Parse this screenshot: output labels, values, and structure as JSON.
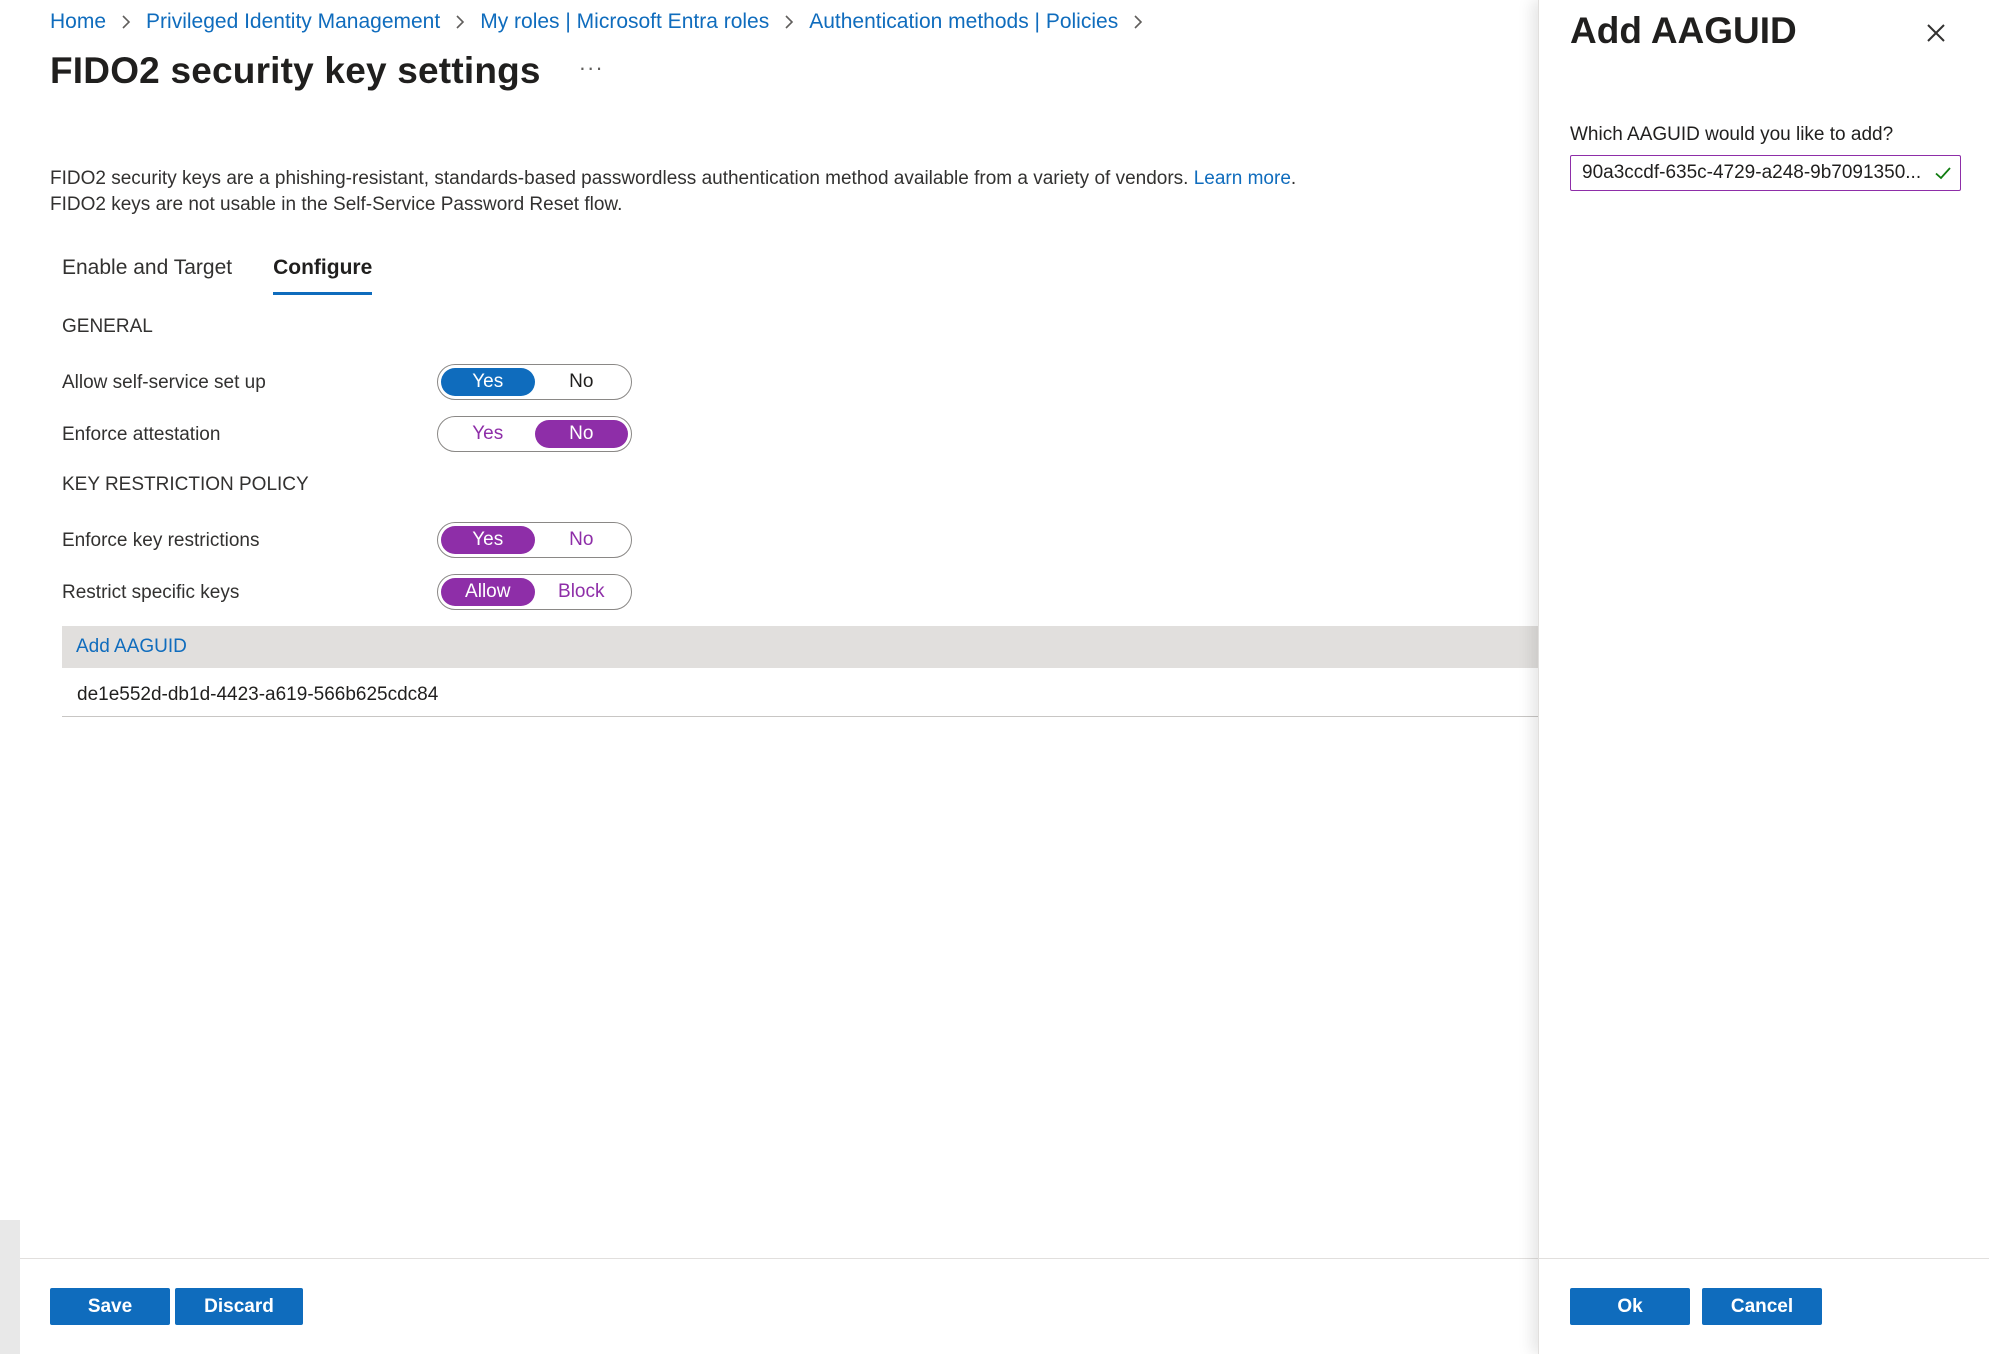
{
  "breadcrumb": [
    {
      "label": "Home"
    },
    {
      "label": "Privileged Identity Management"
    },
    {
      "label": "My roles | Microsoft Entra roles"
    },
    {
      "label": "Authentication methods | Policies"
    }
  ],
  "page": {
    "title": "FIDO2 security key settings",
    "more": "···",
    "description_line1": "FIDO2 security keys are a phishing-resistant, standards-based passwordless authentication method available from a variety of vendors.",
    "learn_more": "Learn more",
    "period": ".",
    "description_line2": "FIDO2 keys are not usable in the Self-Service Password Reset flow."
  },
  "tabs": [
    {
      "label": "Enable and Target",
      "active": false
    },
    {
      "label": "Configure",
      "active": true
    }
  ],
  "general": {
    "section": "GENERAL",
    "self_service": {
      "label": "Allow self-service set up",
      "options": [
        "Yes",
        "No"
      ],
      "selected": "Yes"
    },
    "attestation": {
      "label": "Enforce attestation",
      "options": [
        "Yes",
        "No"
      ],
      "selected": "No"
    }
  },
  "key_restriction": {
    "section": "KEY RESTRICTION POLICY",
    "enforce": {
      "label": "Enforce key restrictions",
      "options": [
        "Yes",
        "No"
      ],
      "selected": "Yes"
    },
    "restrict": {
      "label": "Restrict specific keys",
      "options": [
        "Allow",
        "Block"
      ],
      "selected": "Allow"
    },
    "add_aaguid": "Add AAGUID",
    "aaguids": [
      "de1e552d-db1d-4423-a619-566b625cdc84"
    ]
  },
  "footer": {
    "save": "Save",
    "discard": "Discard"
  },
  "panel": {
    "title": "Add AAGUID",
    "field_label": "Which AAGUID would you like to add?",
    "field_value": "90a3ccdf-635c-4729-a248-9b7091350...",
    "ok": "Ok",
    "cancel": "Cancel"
  },
  "colors": {
    "accent": "#0f6cbd",
    "purple": "#8e2ea8",
    "valid_check": "#107c10"
  },
  "icons": [
    "chevron-right-icon",
    "close-icon",
    "checkmark-icon",
    "more-icon"
  ]
}
